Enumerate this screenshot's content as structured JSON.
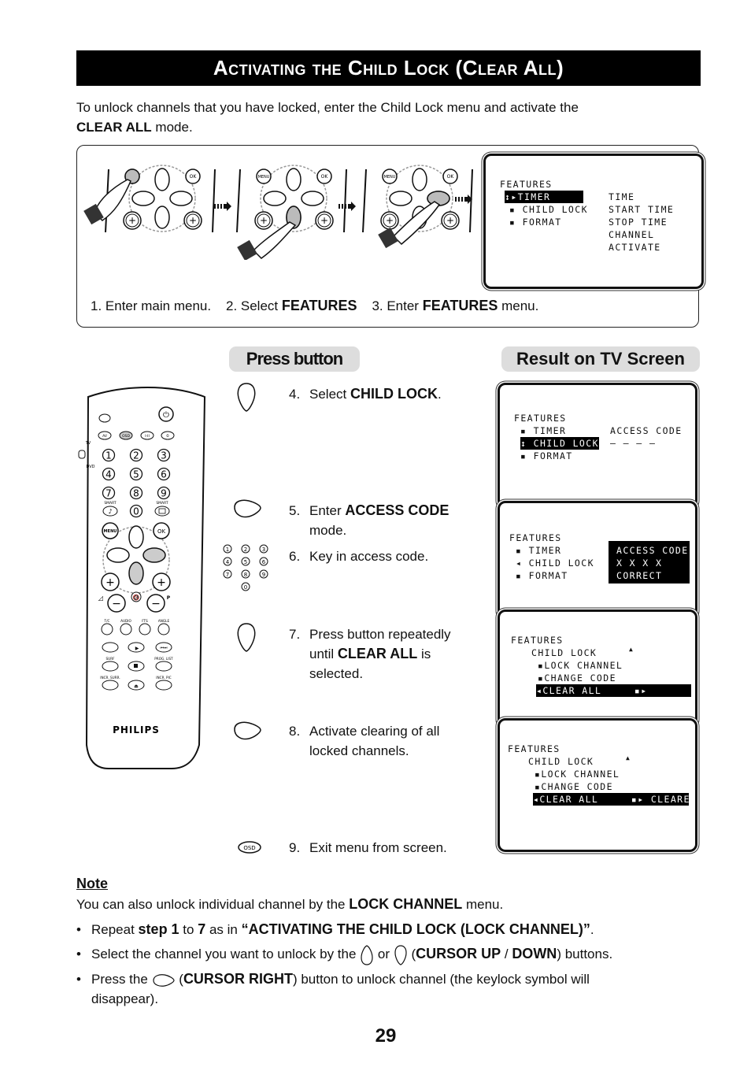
{
  "page": {
    "title": "Activating the Child Lock (Clear All)",
    "page_number": "29"
  },
  "intro": {
    "text_before": "To unlock channels that you have locked, enter the Child Lock menu and activate the",
    "bold": "CLEAR ALL",
    "text_after": " mode."
  },
  "initial_steps": {
    "step1": "1. Enter main menu.",
    "step2_prefix": "2. Select ",
    "step2_bold": "FEATURES",
    "step3_prefix": "3. Enter ",
    "step3_bold": "FEATURES",
    "step3_suffix": " menu.",
    "remote_labels": {
      "menu": "MENU",
      "ok": "OK"
    },
    "screen": {
      "title": "FEATURES",
      "items": [
        "TIMER",
        "CHILD LOCK",
        "FORMAT"
      ],
      "selected": "TIMER",
      "submenu": [
        "TIME",
        "START TIME",
        "STOP TIME",
        "CHANNEL",
        "ACTIVATE"
      ]
    }
  },
  "headers": {
    "press_button": "Press button",
    "result": "Result on TV Screen"
  },
  "steps": [
    {
      "num": "4.",
      "prefix": "Select ",
      "bold": "CHILD LOCK",
      "suffix": ".",
      "button": "cursor-down"
    },
    {
      "num": "5.",
      "prefix": "Enter ",
      "bold": "ACCESS CODE",
      "suffix": "",
      "line2": "mode.",
      "button": "cursor-right"
    },
    {
      "num": "6.",
      "prefix": "Key in access code.",
      "bold": "",
      "suffix": "",
      "button": "number-keys"
    },
    {
      "num": "7.",
      "prefix": "Press button repeatedly",
      "line2_prefix": "until ",
      "line2_bold": "CLEAR ALL",
      "line2_suffix": " is",
      "line3": "selected.",
      "button": "cursor-down"
    },
    {
      "num": "8.",
      "prefix": "Activate clearing of all",
      "line2": "locked channels.",
      "button": "cursor-right"
    },
    {
      "num": "9.",
      "prefix": "Exit menu from screen.",
      "button": "osd"
    }
  ],
  "number_keys": [
    "1",
    "2",
    "3",
    "4",
    "5",
    "6",
    "7",
    "8",
    "9",
    "0"
  ],
  "osd_label": "OSD",
  "screens": [
    {
      "title": "FEATURES",
      "items": [
        "TIMER",
        "CHILD LOCK",
        "FORMAT"
      ],
      "selected": "CHILD LOCK",
      "right_title": "ACCESS CODE",
      "right_value": "– – – –"
    },
    {
      "title": "FEATURES",
      "items": [
        "TIMER",
        "CHILD LOCK",
        "FORMAT"
      ],
      "right_lines": [
        "ACCESS CODE",
        "X X X X",
        "CORRECT"
      ]
    },
    {
      "title": "FEATURES",
      "sub_title": "CHILD LOCK",
      "items": [
        "LOCK CHANNEL",
        "CHANGE CODE",
        "CLEAR ALL"
      ],
      "selected": "CLEAR ALL",
      "status": ""
    },
    {
      "title": "FEATURES",
      "sub_title": "CHILD LOCK",
      "items": [
        "LOCK CHANNEL",
        "CHANGE CODE",
        "CLEAR ALL"
      ],
      "selected": "CLEAR ALL",
      "status": "CLEARED"
    }
  ],
  "remote": {
    "brand": "PHILIPS",
    "switch_labels": [
      "TV",
      "DVD"
    ],
    "top_buttons": [
      "AV",
      "OSD",
      "I-II",
      "⏲"
    ],
    "digits": [
      "1",
      "2",
      "3",
      "4",
      "5",
      "6",
      "7",
      "8",
      "9",
      "0"
    ],
    "smart_label": "SMART",
    "menu": "MENU",
    "ok": "OK",
    "row_labels_1": [
      "T/C",
      "AUDIO",
      "FTS",
      "ANGLE"
    ],
    "row_labels_3": [
      "SURF",
      "",
      "PROG. LIST"
    ],
    "row_labels_4": [
      "INCR. SURR.",
      "",
      "INCR. PIC"
    ],
    "p_label": "P"
  },
  "note": {
    "title": "Note",
    "text_prefix": "You can also unlock individual channel by the ",
    "text_bold": "LOCK CHANNEL",
    "text_suffix": " menu.",
    "bullets": [
      {
        "p1": "Repeat ",
        "b1": "step 1",
        "p2": " to ",
        "b2": "7",
        "p3": " as in ",
        "b3": "“ACTIVATING THE CHILD LOCK (LOCK CHANNEL)”",
        "p4": "."
      },
      {
        "p1": "Select the channel you want to unlock by the ",
        "p2": " or ",
        "p3": " (",
        "b1": "CURSOR UP",
        "p4": " / ",
        "b2": "DOWN",
        "p5": ") buttons."
      },
      {
        "p1": "Press the ",
        "p2": " (",
        "b1": "CURSOR RIGHT",
        "p3": ") button to unlock channel (the keylock symbol will",
        "line2": "disappear)."
      }
    ]
  }
}
